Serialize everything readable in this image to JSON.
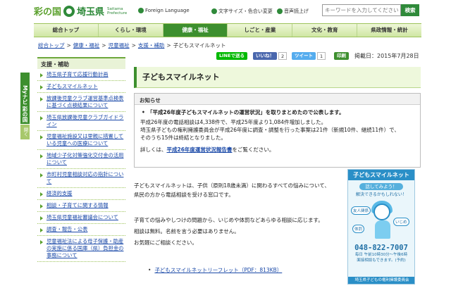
{
  "header": {
    "logo_text": "彩の国",
    "pref_name": "埼玉県",
    "pref_roman_1": "Saitama",
    "pref_roman_2": "Prefecture",
    "foreign_language": "Foreign Language",
    "font_size_color": "文字サイズ・色合い変更",
    "read_aloud": "音声読上げ",
    "search_placeholder": "キーワードを入力してください",
    "search_button": "検索"
  },
  "nav": {
    "items": [
      "総合トップ",
      "くらし・環境",
      "健康・福祉",
      "しごと・産業",
      "文化・教育",
      "県政情報・統計"
    ],
    "active_index": 2
  },
  "breadcrumb": {
    "items": [
      "総合トップ",
      "健康・福祉",
      "児童福祉",
      "支援・補助"
    ],
    "separator": ">",
    "current": "子どもスマイルネット"
  },
  "mynavi": {
    "label": "Myナビ 彩の国",
    "open": "開く"
  },
  "share": {
    "line": "LINEで送る",
    "like": "いいね！",
    "like_count": "2",
    "tweet": "ツイート",
    "tweet_count": "1",
    "print": "印刷"
  },
  "published_date": "掲載日：2015年7月28日",
  "sidebar": {
    "heading": "支援・補助",
    "items": [
      "埼玉県子育て応援行動計画",
      "子どもスマイルネット",
      "放課後児童クラブ運営基準点検表に基づく点検結果について",
      "埼玉県放課後児童クラブガイドライン",
      "児童福祉施設又は里親に措置している児童への医療について",
      "地域少子化対策強化交付金の活用について",
      "市町村児童相談対応の指針について",
      "経済的支援",
      "相談・子育てに関する情報",
      "埼玉県児童福祉審議会について",
      "調査・報告・公表",
      "児童福祉法による母子保護・助産の実施に係る国庫（県）負担金の事務について"
    ]
  },
  "page": {
    "title": "子どもスマイルネット",
    "notice_heading": "お知らせ",
    "notice_lead": "「平成26年度子どもスマイルネットの運営状況」を取りまとめたので公表します。",
    "notice_line1": "平成26年度の電話相談は4,338件で、平成25年度より1,084件増加しました。",
    "notice_line2": "埼玉県子どもの権利擁護委員会が平成26年度に調査・調整を行った事案は21件（新規10件、継続11件）で、",
    "notice_line3": "そのうち15件は終結となりました。",
    "notice_detail_prefix": "詳しくは、",
    "notice_detail_link": "平成26年度運営状況報告書",
    "notice_detail_suffix": "をご覧ください。",
    "intro_1": "子どもスマイルネットは、子供（原則18歳未満）に関わるすべての悩みについて、",
    "intro_2": "県民の方から電話相談を受ける窓口です。",
    "para_1": "子育ての悩みやしつけの問題から、いじめや体罰などあらゆる相談に応じます。",
    "para_2": "相談は無料。名前を言う必要はありません。",
    "para_3": "お気軽にご相談ください。",
    "leaflet_link": "子どもスマイルネットリーフレット（PDF：813KB）"
  },
  "banner": {
    "title": "子どもスマイルネット",
    "sub1": "話してみよう！",
    "sub2": "解決できるかもしれない！",
    "tag1": "友人関係",
    "tag2": "体罰",
    "tag3": "いじめ",
    "phone": "048-822-7007",
    "hours_1": "毎日 午前10時30分～午後6時",
    "hours_2": "面接相談もできます。(予約)",
    "foot": "埼玉県子どもの権利擁護委員会"
  },
  "colors": {
    "brand_green": "#3d8f2e",
    "link_blue": "#1a49a8",
    "banner_blue": "#2a8fc7"
  }
}
